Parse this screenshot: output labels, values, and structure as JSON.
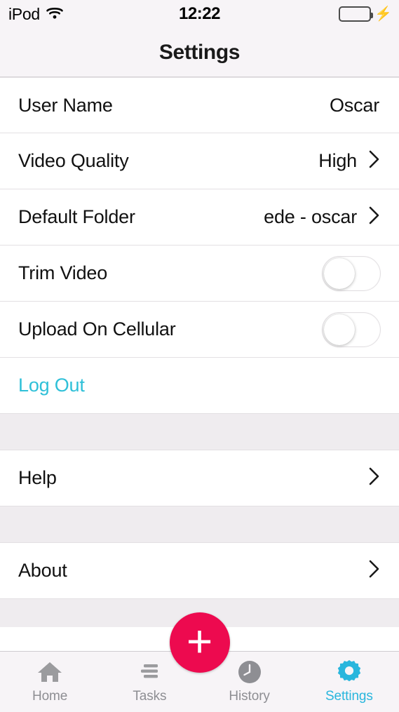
{
  "status_bar": {
    "carrier": "iPod",
    "wifi_icon": "wifi-icon",
    "time": "12:22",
    "battery_icon": "battery-icon",
    "battery_level_pct": 100,
    "charging_icon": "lightning-bolt-icon",
    "battery_color": "#4cd763"
  },
  "nav": {
    "title": "Settings"
  },
  "theme": {
    "accent": "#29b6dd",
    "link": "#2fc0d8",
    "fab": "#ed0a4f",
    "group_bg": "#efecef",
    "bar_bg": "#f7f4f7"
  },
  "settings": {
    "rows": [
      {
        "label": "User Name",
        "value": "Oscar",
        "chevron": false,
        "type": "value"
      },
      {
        "label": "Video Quality",
        "value": "High",
        "chevron": true,
        "type": "value"
      },
      {
        "label": "Default Folder",
        "value": "ede - oscar",
        "chevron": true,
        "type": "value"
      },
      {
        "label": "Trim Video",
        "value": "",
        "chevron": false,
        "type": "switch",
        "switch_on": false
      },
      {
        "label": "Upload On Cellular",
        "value": "",
        "chevron": false,
        "type": "switch",
        "switch_on": false
      },
      {
        "label": "Log Out",
        "value": "",
        "chevron": false,
        "type": "link"
      }
    ],
    "help_row": {
      "label": "Help",
      "chevron": true
    },
    "about_row": {
      "label": "About",
      "chevron": true
    }
  },
  "fab": {
    "icon": "plus-icon",
    "label": "+"
  },
  "tab_bar": {
    "items": [
      {
        "label": "Home",
        "icon": "home-icon",
        "active": false
      },
      {
        "label": "Tasks",
        "icon": "tasks-icon",
        "active": false
      },
      {
        "label": "History",
        "icon": "clock-icon",
        "active": false
      },
      {
        "label": "Settings",
        "icon": "gear-icon",
        "active": true
      }
    ]
  }
}
